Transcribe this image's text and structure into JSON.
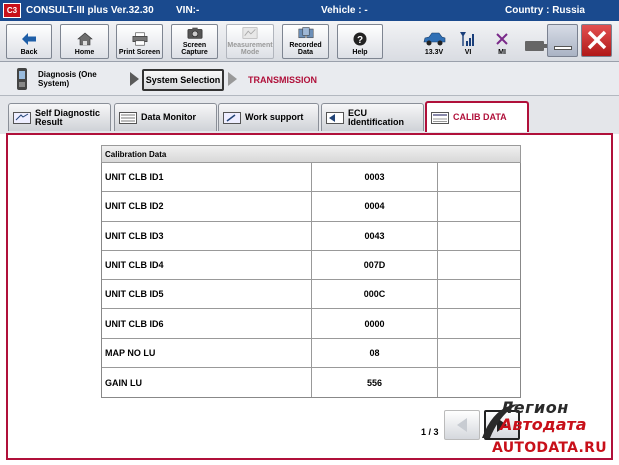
{
  "titlebar": {
    "logo_text": "C3",
    "app": "CONSULT-III plus  Ver.32.30",
    "vin": "VIN:-",
    "vehicle": "Vehicle : -",
    "country": "Country : Russia"
  },
  "toolbar": {
    "back": "Back",
    "home": "Home",
    "print": "Print Screen",
    "capture_1": "Screen",
    "capture_2": "Capture",
    "measure_1": "Measurement",
    "measure_2": "Mode",
    "recorded_1": "Recorded",
    "recorded_2": "Data",
    "help": "Help",
    "battery": "13.3V",
    "vi": "VI",
    "mi": "MI"
  },
  "breadcrumb": {
    "diagnosis_1": "Diagnosis (One",
    "diagnosis_2": "System)",
    "system_selection": "System Selection",
    "current": "TRANSMISSION"
  },
  "tabs": {
    "self_diag_1": "Self Diagnostic",
    "self_diag_2": "Result",
    "data_monitor": "Data Monitor",
    "work_support": "Work support",
    "ecu_1": "ECU",
    "ecu_2": "Identification",
    "calib": "CALIB DATA"
  },
  "table": {
    "header": "Calibration Data",
    "rows": [
      {
        "name": "UNIT CLB ID1",
        "value": "0003"
      },
      {
        "name": "UNIT CLB ID2",
        "value": "0004"
      },
      {
        "name": "UNIT CLB ID3",
        "value": "0043"
      },
      {
        "name": "UNIT CLB ID4",
        "value": "007D"
      },
      {
        "name": "UNIT CLB ID5",
        "value": "000C"
      },
      {
        "name": "UNIT CLB ID6",
        "value": "0000"
      },
      {
        "name": "MAP NO LU",
        "value": "08"
      },
      {
        "name": "GAIN LU",
        "value": "556"
      }
    ]
  },
  "pager": {
    "text": "1 / 3"
  },
  "watermark": {
    "line1": "Легион",
    "line2": "Автодата",
    "line3": "AUTODATA.RU"
  },
  "colors": {
    "titlebar": "#1a4a8e",
    "accent": "#b0103a",
    "close": "#c8101a"
  }
}
